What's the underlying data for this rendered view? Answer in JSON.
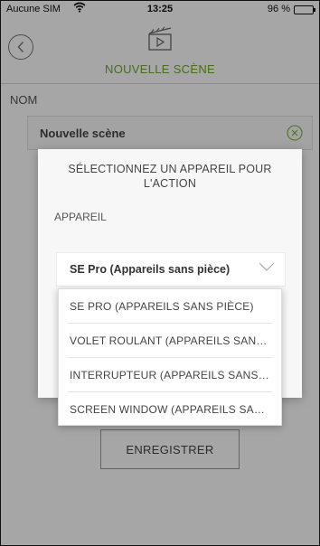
{
  "status_bar": {
    "carrier": "Aucune SIM",
    "wifi_icon": "wifi-icon",
    "time": "13:25",
    "battery": "96 %",
    "battery_level": 0.96
  },
  "header": {
    "back_icon": "chevron-left-icon",
    "scene_icon": "clapperboard-icon",
    "title": "NOUVELLE SCÈNE"
  },
  "form": {
    "name_label": "NOM",
    "name_value": "Nouvelle scène",
    "clear_icon": "clear-circle-icon",
    "save_label": "ENREGISTRER"
  },
  "modal": {
    "title": "SÉLECTIONNEZ UN APPAREIL POUR L'ACTION",
    "device_label": "APPAREIL",
    "selected_device": "SE Pro (Appareils sans pièce)",
    "chevron_icon": "chevron-down-icon"
  },
  "dropdown": {
    "items": [
      "SE PRO (APPAREILS SANS PIÈCE)",
      "VOLET ROULANT (APPAREILS SANS…",
      "INTERRUPTEUR (APPAREILS SANS P…",
      "SCREEN WINDOW (APPAREILS SAN…"
    ]
  },
  "colors": {
    "accent_green": "#6eaa2a",
    "overlay": "rgba(0,0,0,0.35)"
  }
}
